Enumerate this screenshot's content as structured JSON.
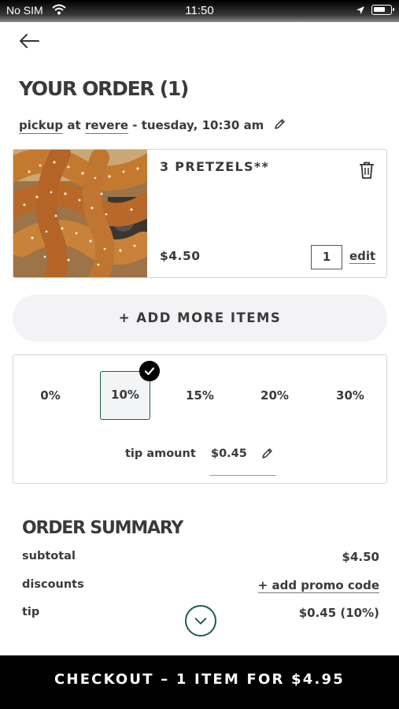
{
  "status_bar": {
    "carrier": "No SIM",
    "time": "11:50"
  },
  "header": {
    "title": "YOUR ORDER (1)"
  },
  "pickup": {
    "mode": "pickup",
    "connector": "at",
    "location": "revere",
    "schedule": "- tuesday, 10:30 am"
  },
  "cart": {
    "items": [
      {
        "name": "3 PRETZELS**",
        "price": "$4.50",
        "quantity": "1",
        "edit_label": "edit"
      }
    ]
  },
  "add_more_label": "+ ADD MORE ITEMS",
  "tip": {
    "options": [
      {
        "label": "0%"
      },
      {
        "label": "10%"
      },
      {
        "label": "15%"
      },
      {
        "label": "20%"
      },
      {
        "label": "30%"
      }
    ],
    "selected": "10%",
    "amount_label": "tip amount",
    "amount": "$0.45"
  },
  "summary": {
    "title": "ORDER SUMMARY",
    "rows": [
      {
        "label": "subtotal",
        "value": "$4.50"
      },
      {
        "label": "discounts",
        "value": "+ add promo code"
      },
      {
        "label": "tip",
        "value": "$0.45 (10%)"
      }
    ]
  },
  "checkout_label": "CHECKOUT – 1 ITEM FOR $4.95",
  "colors": {
    "accent_green": "#1e5e3e",
    "checkout_bg": "#000000",
    "pill_bg": "#f3f3f6"
  },
  "icons": [
    "back-arrow-icon",
    "pencil-icon",
    "trash-icon",
    "checkmark-icon",
    "chevron-down-icon",
    "wifi-icon",
    "location-icon",
    "battery-icon"
  ]
}
